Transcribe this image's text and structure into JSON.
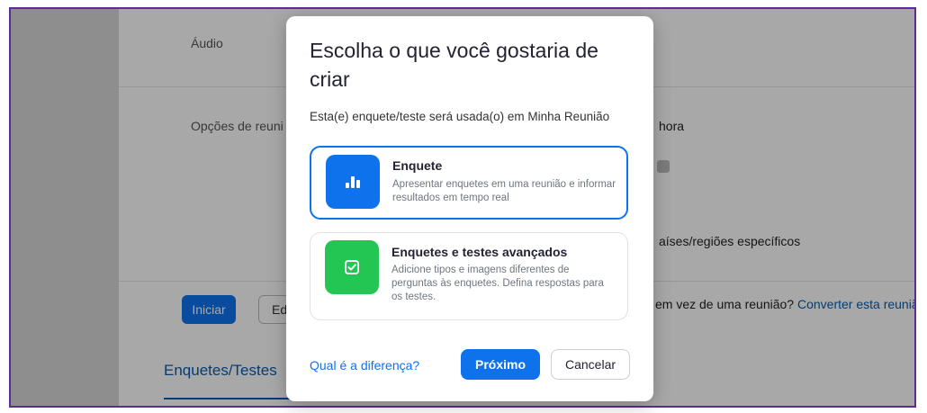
{
  "background": {
    "audio_label": "Áudio",
    "meeting_options_label": "Opções de reuni",
    "time_text": "hora",
    "countries_text": "aíses/regiões específicos",
    "start_button": "Iniciar",
    "edit_button": "Edi",
    "convert_prefix": "em vez de uma reunião?",
    "convert_link": "Converter esta reunião",
    "polls_tab": "Enquetes/Testes"
  },
  "dialog": {
    "title": "Escolha o que você gostaria de criar",
    "subtitle": "Esta(e) enquete/teste será usada(o) em Minha Reunião",
    "options": [
      {
        "title": "Enquete",
        "description": "Apresentar enquetes em uma reunião e informar resultados em tempo real",
        "icon": "bar-chart-icon",
        "color": "#0e72ed",
        "selected": true
      },
      {
        "title": "Enquetes e testes avançados",
        "description": "Adicione tipos e imagens diferentes de perguntas às enquetes. Defina respostas para os testes.",
        "icon": "checkbox-icon",
        "color": "#23c553",
        "selected": false
      }
    ],
    "difference_link": "Qual é a diferença?",
    "next_button": "Próximo",
    "cancel_button": "Cancelar"
  }
}
